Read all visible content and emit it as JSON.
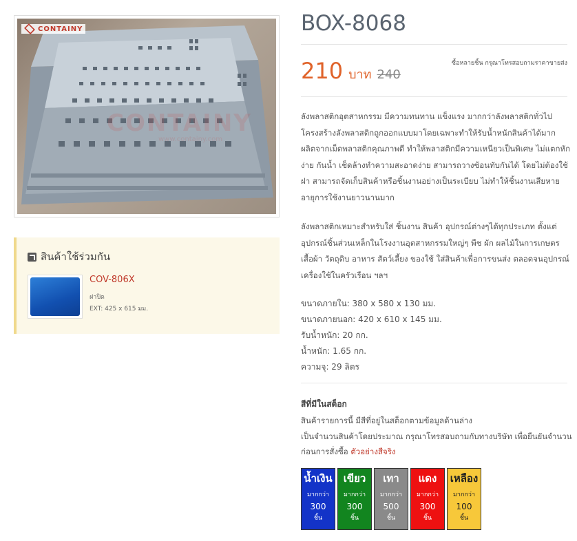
{
  "image": {
    "brand_logo_text": "CONTAINY",
    "watermark_text": "CONTAINY",
    "watermark_sub": "www.containy.com"
  },
  "related": {
    "heading": "สินค้าใช้ร่วมกัน",
    "items": [
      {
        "code": "COV-806X",
        "desc": "ฝาปิด",
        "ext": "EXT: 425 x 615 มม."
      }
    ]
  },
  "product": {
    "title": "BOX-8068",
    "price": "210",
    "currency": "บาท",
    "old_price": "240",
    "bulk_note": "ซื้อหลายชิ้น กรุณาโทรสอบถามราคาขายส่ง",
    "description_1": "ลังพลาสติกอุตสาหกรรม มีความทนทาน แข็งแรง มากกว่าลังพลาสติกทั่วไป โครงสร้างลังพลาสติกถูกออกแบบมาโดยเฉพาะทำให้รับน้ำหนักสินค้าได้มาก ผลิตจากเม็ดพลาสติกคุณภาพดี ทำให้พลาสติกมีความเหนียวเป็นพิเศษ ไม่แตกหักง่าย กันน้ำ เช็ดล้างทำความสะอาดง่าย สามารถวางซ้อนทับกันได้ โดยไม่ต้องใช้ฝา สามารถจัดเก็บสินค้าหรือชิ้นงานอย่างเป็นระเบียบ ไม่ทำให้ชิ้นงานเสียหาย อายุการใช้งานยาวนานมาก",
    "description_2": "ลังพลาสติกเหมาะสำหรับใส่ ชิ้นงาน สินค้า อุปกรณ์ต่างๆได้ทุกประเภท ตั้งแต่อุปกรณ์ชิ้นส่วนเหล็กในโรงงานอุตสาหกรรมใหญ่ๆ พืช ผัก ผลไม้ในการเกษตร เสื้อผ้า วัตถุดิบ อาหาร สัตว์เลี้ยง ของใช้ ใส่สินค้าเพื่อการขนส่ง ตลอดจนอุปกรณ์เครื่องใช้ในครัวเรือน ฯลฯ",
    "specs": [
      "ขนาดภายใน: 380 x 580 x 130 มม.",
      "ขนาดภายนอก: 420 x 610 x 145 มม.",
      "รับน้ำหนัก: 20 กก.",
      "น้ำหนัก: 1.65 กก.",
      "ความจุ: 29 ลิตร"
    ]
  },
  "stock": {
    "title": "สีที่มีในสต็อก",
    "line1": "สินค้ารายการนี้ มีสีที่อยู่ในสต็อกตามข้อมูลด้านล่าง",
    "line2": "เป็นจำนวนสินค้าโดยประมาณ กรุณาโทรสอบถามกับทางบริษัท เพื่อยืนยันจำนวนก่อนการสั่งซื้อ",
    "link": "ตัวอย่างสีจริง",
    "colors": [
      {
        "name": "น้ำเงิน",
        "more": "มากกว่า",
        "qty": "300",
        "unit": "ชิ้น",
        "bg": "#1333c8"
      },
      {
        "name": "เขียว",
        "more": "มากกว่า",
        "qty": "300",
        "unit": "ชิ้น",
        "bg": "#12851f"
      },
      {
        "name": "เทา",
        "more": "มากกว่า",
        "qty": "500",
        "unit": "ชิ้น",
        "bg": "#8a8a8a"
      },
      {
        "name": "แดง",
        "more": "มากกว่า",
        "qty": "300",
        "unit": "ชิ้น",
        "bg": "#ee1111"
      },
      {
        "name": "เหลือง",
        "more": "มากกว่า",
        "qty": "100",
        "unit": "ชิ้น",
        "bg": "#f7c83a"
      }
    ]
  }
}
